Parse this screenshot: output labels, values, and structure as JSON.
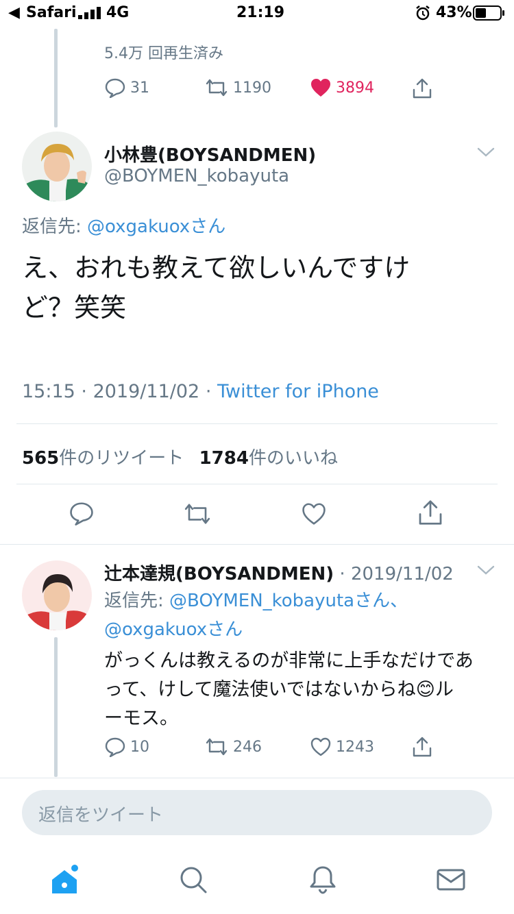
{
  "status_bar": {
    "back_app": "Safari",
    "network": "4G",
    "time": "21:19",
    "battery": "43%"
  },
  "tweet1_stub": {
    "views": "5.4万 回再生済み",
    "reply_count": "31",
    "retweet_count": "1190",
    "like_count": "3894"
  },
  "main_tweet": {
    "display_name": "小林豊(BOYSANDMEN)",
    "handle": "@BOYMEN_kobayuta",
    "reply_to_label": "返信先:",
    "reply_to_user": "@oxgakuoxさん",
    "text_line1": "え、おれも教えて欲しいんですけ",
    "text_line2": "ど？笑笑",
    "time": "15:15",
    "date": "2019/11/02",
    "source": "Twitter for iPhone",
    "retweets_num": "565",
    "retweets_label": "件のリツイート",
    "likes_num": "1784",
    "likes_label": "件のいいね"
  },
  "reply_tweet": {
    "display_name": "辻本達規(BOYSANDMEN)",
    "date": "2019/11/02",
    "reply_to_label": "返信先:",
    "reply_to_user1": "@BOYMEN_kobayutaさん、",
    "reply_to_user2": "@oxgakuoxさん",
    "text_line1": "がっくんは教えるのが非常に上手なだけであ",
    "text_line2": "って、けして魔法使いではないからね",
    "text_line2_emoji": "😊",
    "text_line2_tail": "ル",
    "text_line3": "ーモス。",
    "reply_count": "10",
    "retweet_count": "246",
    "like_count": "1243"
  },
  "reply_composer": {
    "placeholder": "返信をツイート"
  },
  "tab_bar": {
    "items": [
      "home",
      "search",
      "notifications",
      "messages"
    ]
  },
  "colors": {
    "accent": "#1da1f2",
    "like": "#e0245e",
    "link": "#3a8fd6",
    "muted": "#657786"
  }
}
